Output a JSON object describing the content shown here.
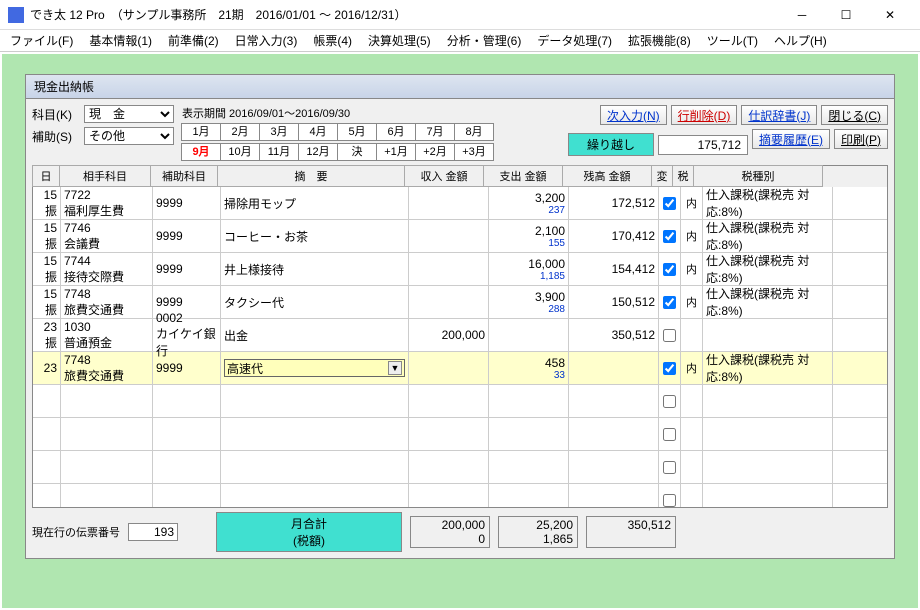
{
  "title": "でき太 12 Pro　（サンプル事務所　21期　2016/01/01 ～ 2016/12/31）",
  "menu": [
    "ファイル(F)",
    "基本情報(1)",
    "前準備(2)",
    "日常入力(3)",
    "帳票(4)",
    "決算処理(5)",
    "分析・管理(6)",
    "データ処理(7)",
    "拡張機能(8)",
    "ツール(T)",
    "ヘルプ(H)"
  ],
  "panel_title": "現金出納帳",
  "labels": {
    "subject": "科目(K)",
    "aux": "補助(S)",
    "period": "表示期間 2016/09/01～2016/09/30"
  },
  "subject_val": "現　金",
  "aux_val": "その他",
  "months_row1": [
    "1月",
    "2月",
    "3月",
    "4月",
    "5月",
    "6月",
    "7月",
    "8月"
  ],
  "months_row2": [
    "9月",
    "10月",
    "11月",
    "12月",
    "決",
    "+1月",
    "+2月",
    "+3月"
  ],
  "btns": {
    "next": "次入力(N)",
    "delete": "行削除(D)",
    "dict": "仕訳辞書(J)",
    "close": "閉じる(C)",
    "hist": "摘要履歴(E)",
    "print": "印刷(P)"
  },
  "carry": {
    "label": "繰り越し",
    "value": "175,712"
  },
  "headers": {
    "day": "日",
    "acc": "相手科目",
    "sub": "補助科目",
    "desc": "摘　要",
    "in": "収入 金額",
    "out": "支出 金額",
    "bal": "残高 金額",
    "chg": "変",
    "tax": "税",
    "taxt": "税種別"
  },
  "rows": [
    {
      "d1": "15",
      "d2": "振",
      "a1": "7722",
      "a2": "福利厚生費",
      "s": "9999",
      "desc": "掃除用モップ",
      "in": "",
      "o1": "3,200",
      "o2": "237",
      "bal": "172,512",
      "chk": true,
      "tax": "内",
      "tt": "仕入課税(課税売 対応:8%)"
    },
    {
      "d1": "15",
      "d2": "振",
      "a1": "7746",
      "a2": "会議費",
      "s": "9999",
      "desc": "コーヒー・お茶",
      "in": "",
      "o1": "2,100",
      "o2": "155",
      "bal": "170,412",
      "chk": true,
      "tax": "内",
      "tt": "仕入課税(課税売 対応:8%)"
    },
    {
      "d1": "15",
      "d2": "振",
      "a1": "7744",
      "a2": "接待交際費",
      "s": "9999",
      "desc": "井上様接待",
      "in": "",
      "o1": "16,000",
      "o2": "1,185",
      "bal": "154,412",
      "chk": true,
      "tax": "内",
      "tt": "仕入課税(課税売 対応:8%)"
    },
    {
      "d1": "15",
      "d2": "振",
      "a1": "7748",
      "a2": "旅費交通費",
      "s": "9999",
      "desc": "タクシー代",
      "in": "",
      "o1": "3,900",
      "o2": "288",
      "bal": "150,512",
      "chk": true,
      "tax": "内",
      "tt": "仕入課税(課税売 対応:8%)"
    },
    {
      "d1": "23",
      "d2": "振",
      "a1": "1030",
      "a2": "普通預金",
      "s1": "0002",
      "s2": "カイケイ銀行",
      "desc": "出金",
      "in": "200,000",
      "o1": "",
      "o2": "",
      "bal": "350,512",
      "chk": false,
      "tax": "",
      "tt": ""
    },
    {
      "d1": "23",
      "d2": "",
      "a1": "7748",
      "a2": "旅費交通費",
      "s": "9999",
      "desc": "高速代",
      "in": "",
      "o1": "458",
      "o2": "33",
      "bal": "",
      "chk": true,
      "tax": "内",
      "tt": "仕入課税(課税売 対応:8%)",
      "sel": true
    }
  ],
  "footer": {
    "slip_lbl": "現在行の伝票番号",
    "slip_val": "193",
    "total_lbl1": "月合計",
    "total_lbl2": "(税額)",
    "in1": "200,000",
    "in2": "0",
    "out1": "25,200",
    "out2": "1,865",
    "bal": "350,512"
  }
}
